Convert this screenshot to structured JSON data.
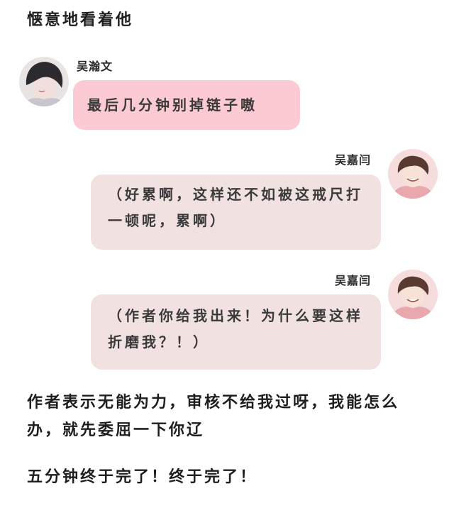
{
  "narration": {
    "top": "惬意地看着他",
    "middle": "作者表示无能为力，审核不给我过呀，我能怎么办，就先委屈一下你辽",
    "ending": "五分钟终于完了！终于完了！"
  },
  "messages": [
    {
      "sender": "吴瀚文",
      "side": "left",
      "text": "最后几分钟别掉链子嗷"
    },
    {
      "sender": "吴嘉闫",
      "side": "right",
      "text": "（好累啊，这样还不如被这戒尺打一顿呢，累啊）"
    },
    {
      "sender": "吴嘉闫",
      "side": "right",
      "text": "（作者你给我出来！为什么要这样折磨我？！）"
    }
  ]
}
